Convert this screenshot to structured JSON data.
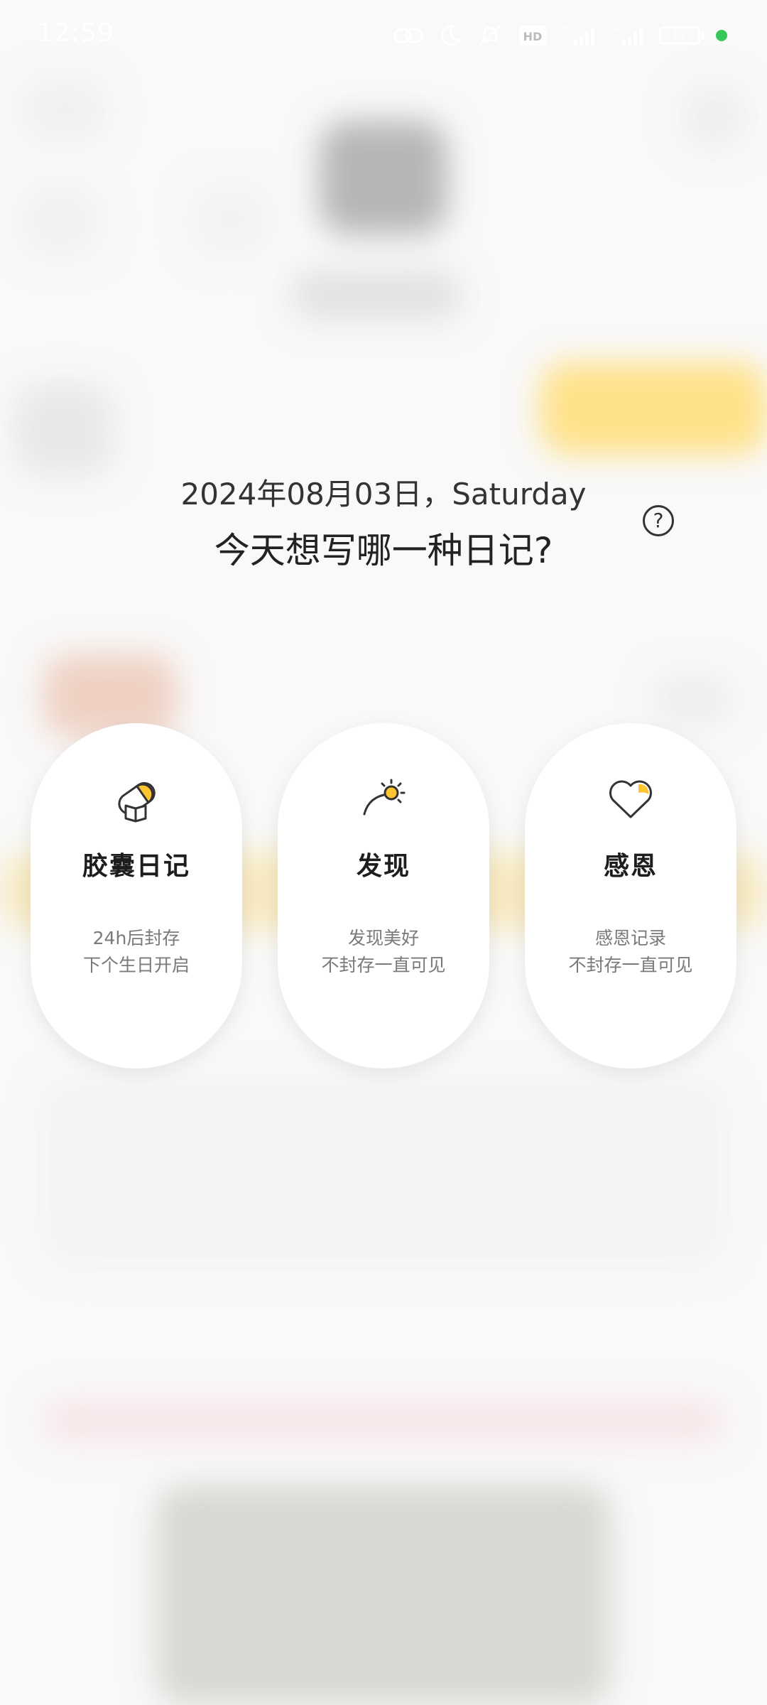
{
  "status_bar": {
    "time": "12:59",
    "battery": "67"
  },
  "header": {
    "date": "2024年08月03日，Saturday",
    "question": "今天想写哪一种日记?",
    "help_icon_glyph": "?"
  },
  "options": [
    {
      "title": "胶囊日记",
      "line1": "24h后封存",
      "line2": "下个生日开启",
      "icon": "capsule-icon"
    },
    {
      "title": "发现",
      "line1": "发现美好",
      "line2": "不封存一直可见",
      "icon": "sun-horizon-icon"
    },
    {
      "title": "感恩",
      "line1": "感恩记录",
      "line2": "不封存一直可见",
      "icon": "heart-icon"
    }
  ],
  "colors": {
    "accent": "#ffc531",
    "text": "#222222",
    "subtext": "#7a7a7a"
  }
}
